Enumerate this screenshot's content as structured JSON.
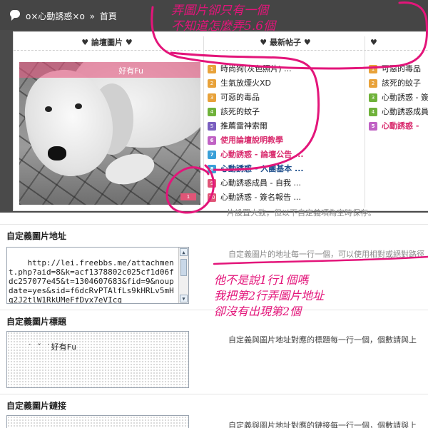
{
  "breadcrumb": {
    "forum": "o×心動誘惑×o",
    "separator": "»",
    "home": "首頁"
  },
  "preview": {
    "columns": [
      "♥ 論壇圖片 ♥",
      "♥ 最新帖子 ♥",
      "♥"
    ],
    "slide_caption": "好有Fu",
    "slide_pager": "1",
    "list1": [
      {
        "rank": "1",
        "color": "#e8a23a",
        "title": "時尚狗(灰色照片) ...",
        "style": ""
      },
      {
        "rank": "2",
        "color": "#e8a23a",
        "title": "生氣放煙火XD",
        "style": ""
      },
      {
        "rank": "3",
        "color": "#e8a23a",
        "title": "可惡的毒品",
        "style": ""
      },
      {
        "rank": "4",
        "color": "#6fb23a",
        "title": "該死的蚊子",
        "style": ""
      },
      {
        "rank": "5",
        "color": "#7a5fc0",
        "title": "推薦雷神索爾",
        "style": ""
      },
      {
        "rank": "6",
        "color": "#c062c4",
        "title": "使用論壇說明教學",
        "style": "hl"
      },
      {
        "rank": "7",
        "color": "#3aa0d8",
        "title": "心動誘惑 - 論壇公告 ...",
        "style": "hl"
      },
      {
        "rank": "8",
        "color": "#3aa0d8",
        "title": "心動誘惑 - 入團基本 ...",
        "style": "blue"
      },
      {
        "rank": "9",
        "color": "#e05577",
        "title": "心動誘惑成員 - 自我 ...",
        "style": ""
      },
      {
        "rank": "10",
        "color": "#e05577",
        "title": "心動誘惑 - 簽名報告 ...",
        "style": ""
      }
    ],
    "list2": [
      {
        "rank": "1",
        "color": "#e8a23a",
        "title": "可惡的毒品",
        "style": ""
      },
      {
        "rank": "2",
        "color": "#e8a23a",
        "title": "該死的蚊子",
        "style": ""
      },
      {
        "rank": "3",
        "color": "#6fb23a",
        "title": "心動誘惑 - 簽",
        "style": ""
      },
      {
        "rank": "4",
        "color": "#6fb23a",
        "title": "心動誘惑成員",
        "style": ""
      },
      {
        "rank": "5",
        "color": "#c062c4",
        "title": "心動誘惑 -",
        "style": "hl"
      }
    ]
  },
  "form": {
    "cut_note": "片設置大致，但以下自定義項為空時保存。",
    "image_url": {
      "label": "自定義圖片地址",
      "value": "http://lei.freebbs.me/attachment.php?aid=8&k=acf1378802c025cf1d06fdc257077e45&t=1304607683&fid=9&noupdate=yes&sid=f6dcRvPTAlfLs9kHRLv5mHq2J2tlW1RkUMeFfDyx7eVIcq",
      "tip": "自定義圖片的地址每一行一個，可以使用相對或絕對路徑"
    },
    "image_title": {
      "label": "自定義圖片標題",
      "value": "˙ ˇ ˙好有Fu",
      "tip": "自定義與圖片地址對應的標題每一行一個，個數請與上"
    },
    "image_link": {
      "label": "自定義圖片鏈接",
      "tip": "自定義與圖片地址對應的鏈接每一行一個，個數請與上"
    }
  },
  "annotations": {
    "top": [
      "弄圖片卻只有一個",
      "不知道怎麼弄5.6個"
    ],
    "right": [
      "他不是說1行1個嗎",
      "我把第2行弄圖片地址",
      "卻沒有出現第2個"
    ],
    "ink_color": "#e3157a"
  }
}
